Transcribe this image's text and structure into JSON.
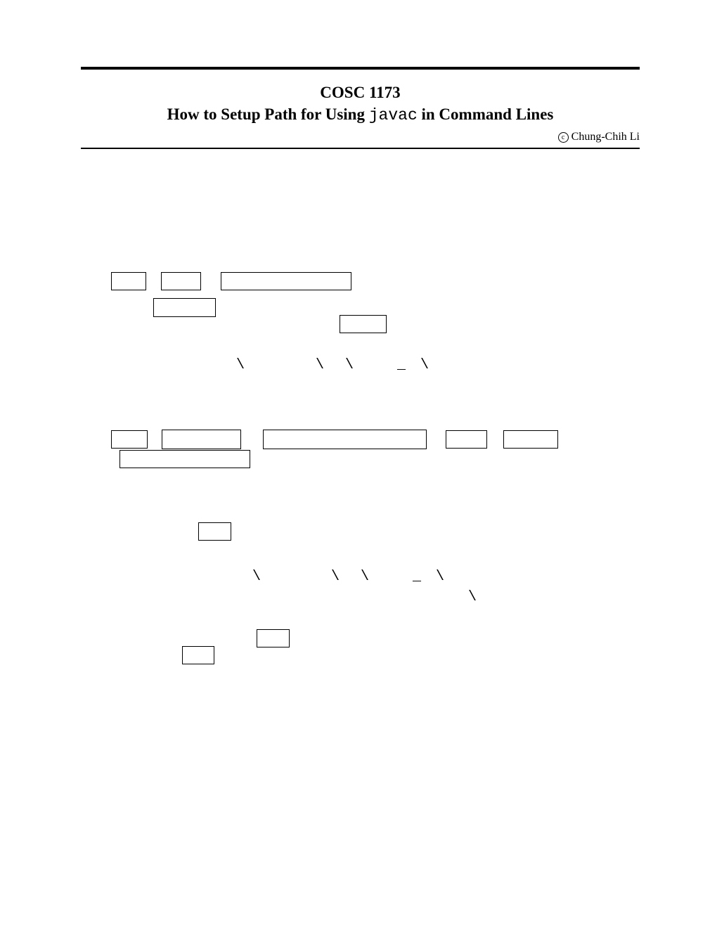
{
  "header": {
    "course": "COSC 1173",
    "title_prefix": "How to Setup Path for Using ",
    "title_code": "javac",
    "title_suffix": " in Command Lines",
    "copyright_symbol": "c",
    "copyright_name": "Chung-Chih Li"
  },
  "glyphs": {
    "backslash": "\\",
    "underscore": "_"
  }
}
